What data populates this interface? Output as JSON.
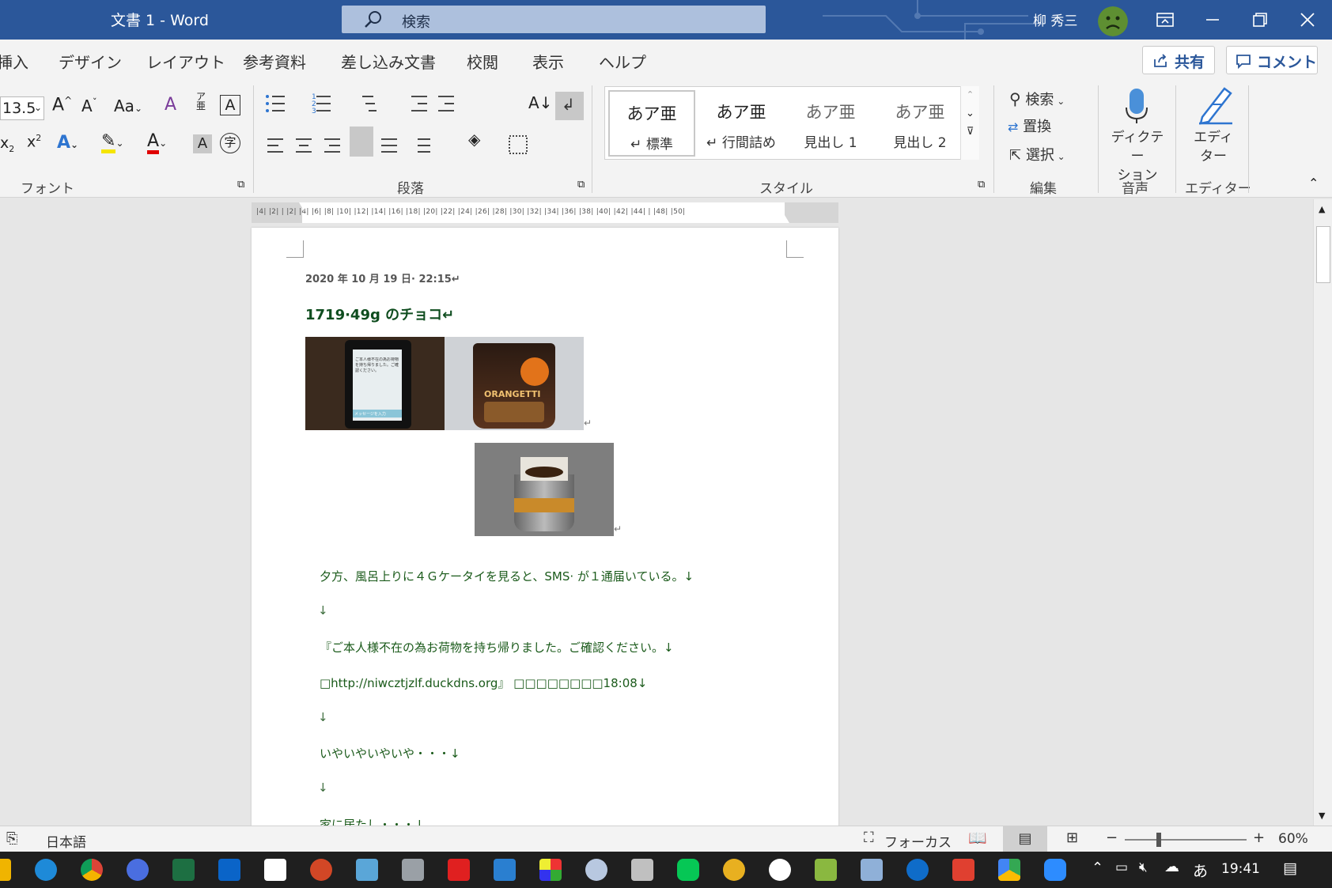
{
  "titlebar": {
    "doc_title": "文書 1  -  Word",
    "search_placeholder": "検索",
    "user_name": "柳 秀三"
  },
  "tabs": [
    "挿入",
    "デザイン",
    "レイアウト",
    "参考資料",
    "差し込み文書",
    "校閲",
    "表示",
    "ヘルプ"
  ],
  "share_label": "共有",
  "comment_label": "コメント",
  "ribbon": {
    "font_size": "13.5",
    "group_labels": {
      "font": "フォント",
      "paragraph": "段落",
      "styles": "スタイル",
      "editing": "編集",
      "voice": "音声",
      "editor": "エディター"
    },
    "styles": [
      {
        "preview": "あア亜",
        "name": "↵ 標準"
      },
      {
        "preview": "あア亜",
        "name": "↵ 行間詰め"
      },
      {
        "preview": "あア亜",
        "name": "見出し 1"
      },
      {
        "preview": "あア亜",
        "name": "見出し 2"
      }
    ],
    "editing": {
      "find": "検索",
      "replace": "置換",
      "select": "選択"
    },
    "dictation": "ディクテー\nション",
    "editor": "エディ\nター"
  },
  "ruler_ticks": "|4| |2| |  |2| |4| |6| |8| |10| |12| |14| |16| |18| |20| |22| |24| |26| |28| |30| |32| |34| |36| |38| |40| |42| |44| |  |48| |50|",
  "document": {
    "date": "2020 年 10 月 19 日· 22:15↵",
    "title": "1719·49g のチョコ↵",
    "lines": [
      "夕方、風呂上りに４Ｇケータイを見ると、SMS· が１通届いている。↓",
      "↓",
      "『ご本人様不在の為お荷物を持ち帰りました。ご確認ください。↓",
      "□http://niwcztjzlf.duckdns.org』 □□□□□□□□18:08↓",
      "↓",
      "いやいやいやいや・・・↓",
      "↓",
      "家に居たし・・・↓"
    ],
    "phone_text": "ご本人様不在の為お荷物を持ち帰りました。ご確認ください。",
    "phone_input": "メッセージを入力",
    "choco_brand": "ORANGETTI"
  },
  "status": {
    "language": "日本語",
    "focus": "フォーカス",
    "zoom": "60%"
  },
  "taskbar": {
    "ime": "あ",
    "time": "19:41"
  },
  "colors": {
    "title_bar": "#2b579a",
    "ribbon_bg": "#f3f3f3",
    "doc_text": "#1a5a1a",
    "taskbar": "#1f1f1f"
  }
}
